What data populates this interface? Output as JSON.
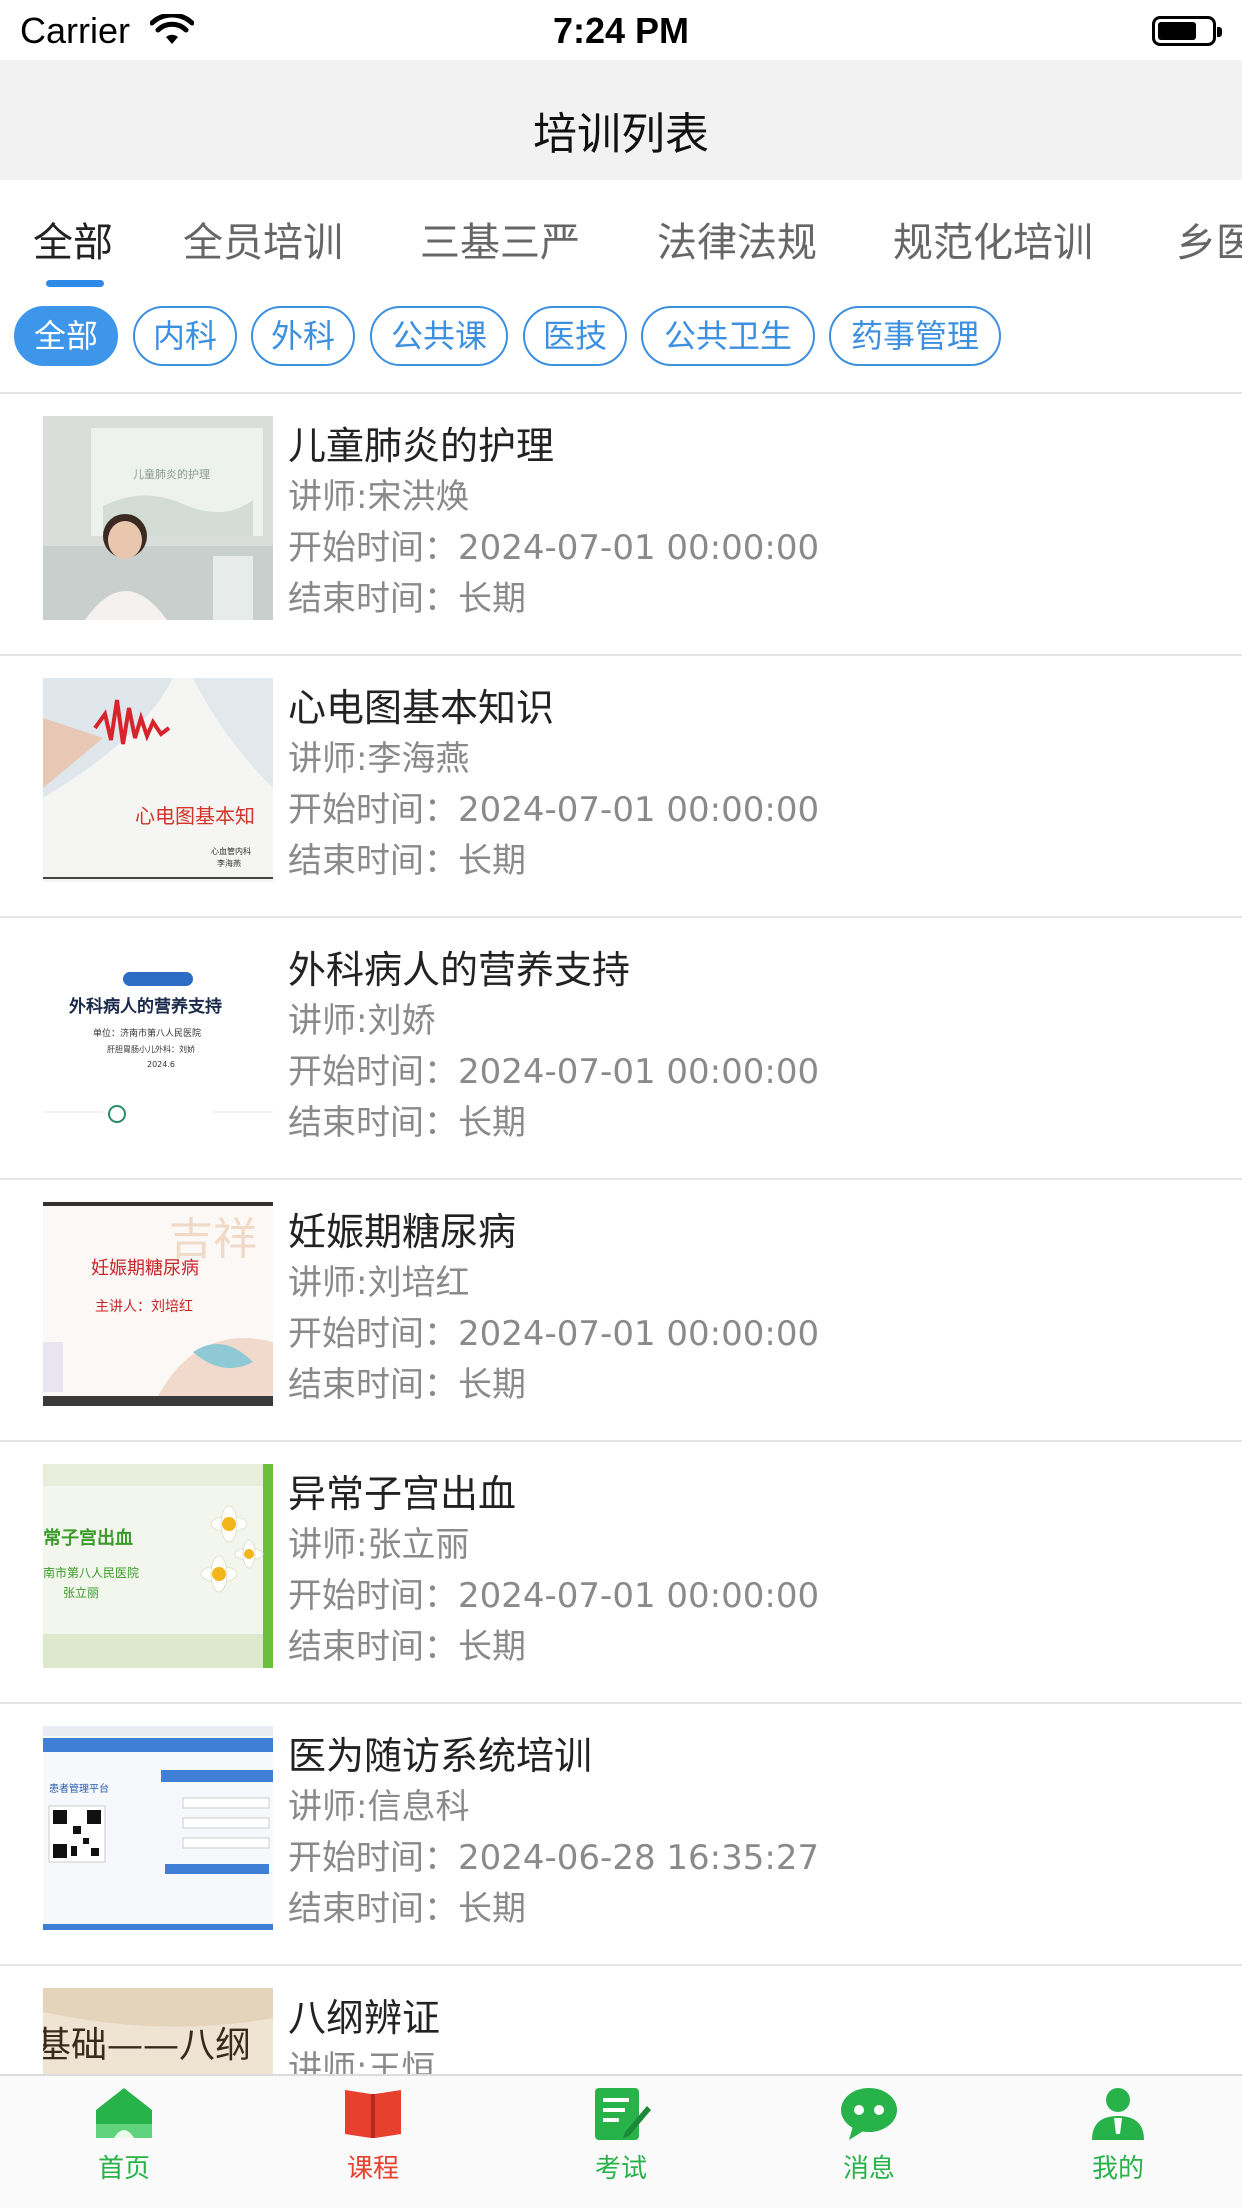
{
  "status_bar": {
    "carrier": "Carrier",
    "time": "7:24 PM"
  },
  "nav": {
    "title": "培训列表"
  },
  "tabs": [
    "全部",
    "全员培训",
    "三基三严",
    "法律法规",
    "规范化培训",
    "乡医"
  ],
  "chips": [
    "全部",
    "内科",
    "外科",
    "公共课",
    "医技",
    "公共卫生",
    "药事管理"
  ],
  "courses": [
    {
      "title": "儿童肺炎的护理",
      "teacher": "讲师:宋洪焕",
      "start": "开始时间：2024-07-01 00:00:00",
      "end": "结束时间：长期",
      "thumb_text": "儿童肺炎的护理"
    },
    {
      "title": "心电图基本知识",
      "teacher": "讲师:李海燕",
      "start": "开始时间：2024-07-01 00:00:00",
      "end": "结束时间：长期",
      "thumb_text": "心电图基本知",
      "thumb_sub1": "心血管内科",
      "thumb_sub2": "李海燕"
    },
    {
      "title": "外科病人的营养支持",
      "teacher": "讲师:刘娇",
      "start": "开始时间：2024-07-01 00:00:00",
      "end": "结束时间：长期",
      "thumb_text": "外科病人的营养支持",
      "thumb_sub1": "单位：济南市第八人民医院",
      "thumb_sub2": "肝胆胃肠小儿外科：刘娇",
      "thumb_sub3": "2024.6"
    },
    {
      "title": "妊娠期糖尿病",
      "teacher": "讲师:刘培红",
      "start": "开始时间：2024-07-01 00:00:00",
      "end": "结束时间：长期",
      "thumb_text": "妊娠期糖尿病",
      "thumb_sub1": "主讲人：刘培红"
    },
    {
      "title": "异常子宫出血",
      "teacher": "讲师:张立丽",
      "start": "开始时间：2024-07-01 00:00:00",
      "end": "结束时间：长期",
      "thumb_text": "常子宫出血",
      "thumb_sub1": "南市第八人民医院",
      "thumb_sub2": "张立丽"
    },
    {
      "title": "医为随访系统培训",
      "teacher": "讲师:信息科",
      "start": "开始时间：2024-06-28 16:35:27",
      "end": "结束时间：长期",
      "thumb_text": "患者管理平台"
    },
    {
      "title": "八纲辨证",
      "teacher": "讲师:王恒",
      "start": "",
      "end": "",
      "thumb_text": "基础——八纲"
    }
  ],
  "tabbar": [
    {
      "label": "首页",
      "icon": "home-icon",
      "color": "#27b24a"
    },
    {
      "label": "课程",
      "icon": "book-icon",
      "color": "#e8402f"
    },
    {
      "label": "考试",
      "icon": "exam-icon",
      "color": "#27b24a"
    },
    {
      "label": "消息",
      "icon": "message-icon",
      "color": "#27b24a"
    },
    {
      "label": "我的",
      "icon": "user-icon",
      "color": "#27b24a"
    }
  ],
  "colors": {
    "accent": "#3d96ea",
    "tabbar_active": "#e8402f",
    "tabbar_green": "#27b24a"
  }
}
